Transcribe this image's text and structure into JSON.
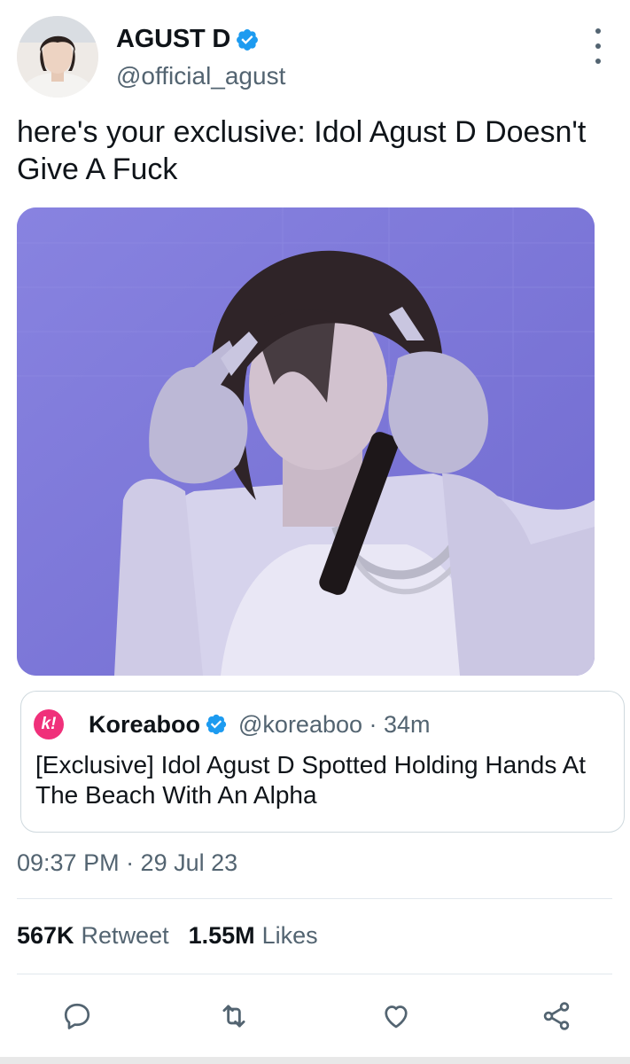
{
  "author": {
    "display_name": "AGUST D",
    "handle": "@official_agust",
    "verified": true
  },
  "tweet": {
    "text": "here's your exclusive: Idol Agust D Doesn't Give A Fuck",
    "timestamp": "09:37 PM · 29 Jul 23"
  },
  "quote_tweet": {
    "logo_letter": "k!",
    "display_name": "Koreaboo",
    "handle_time": "@koreaboo · 34m",
    "text": "[Exclusive] Idol Agust D Spotted Holding Hands At The Beach With An Alpha"
  },
  "stats": {
    "retweets_count": "567K",
    "retweets_label": "Retweet",
    "likes_count": "1.55M",
    "likes_label": "Likes"
  },
  "icons": {
    "verified": "verified-badge-icon",
    "more": "more-vertical-icon",
    "reply": "reply-icon",
    "retweet": "retweet-icon",
    "like": "heart-icon",
    "share": "share-icon"
  },
  "colors": {
    "verified_blue": "#1d9bf0",
    "koreaboo_pink": "#f0307a",
    "muted_text": "#536471",
    "media_background": "#7f79d9"
  }
}
